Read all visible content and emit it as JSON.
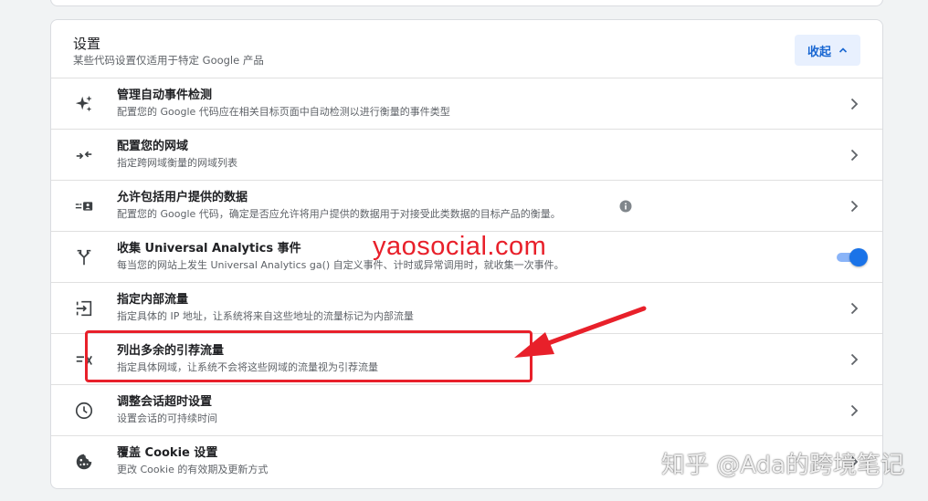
{
  "settings": {
    "title": "设置",
    "subtitle": "某些代码设置仅适用于特定 Google 产品",
    "collapse_label": "收起",
    "rows": [
      {
        "title": "管理自动事件检测",
        "desc": "配置您的 Google 代码应在相关目标页面中自动检测以进行衡量的事件类型",
        "icon": "sparkle-icon",
        "control": "chevron"
      },
      {
        "title": "配置您的网域",
        "desc": "指定跨网域衡量的网域列表",
        "icon": "merge-arrows-icon",
        "control": "chevron"
      },
      {
        "title": "允许包括用户提供的数据",
        "desc": "配置您的 Google 代码，确定是否应允许将用户提供的数据用于对接受此类数据的目标产品的衡量。",
        "icon": "user-data-icon",
        "control": "chevron"
      },
      {
        "title": "收集 Universal Analytics 事件",
        "desc": "每当您的网站上发生 Universal Analytics ga() 自定义事件、计时或异常调用时，就收集一次事件。",
        "icon": "fork-icon",
        "control": "toggle"
      },
      {
        "title": "指定内部流量",
        "desc": "指定具体的 IP 地址，让系统将来自这些地址的流量标记为内部流量",
        "icon": "login-icon",
        "control": "chevron"
      },
      {
        "title": "列出多余的引荐流量",
        "desc": "指定具体网域，让系统不会将这些网域的流量视为引荐流量",
        "icon": "filter-off-icon",
        "control": "chevron"
      },
      {
        "title": "调整会话超时设置",
        "desc": "设置会话的可持续时间",
        "icon": "clock-icon",
        "control": "chevron"
      },
      {
        "title": "覆盖 Cookie 设置",
        "desc": "更改 Cookie 的有效期及更新方式",
        "icon": "cookie-icon",
        "control": "chevron"
      }
    ]
  },
  "toggle_state": {
    "ua_events_enabled": true
  },
  "overlay": {
    "site_watermark": "yaosocial.com",
    "zhihu_watermark": "知乎 @Ada的跨境笔记"
  },
  "colors": {
    "accent": "#1a73e8",
    "button_bg": "#e8f0fe",
    "annotation_red": "#e8202a"
  }
}
